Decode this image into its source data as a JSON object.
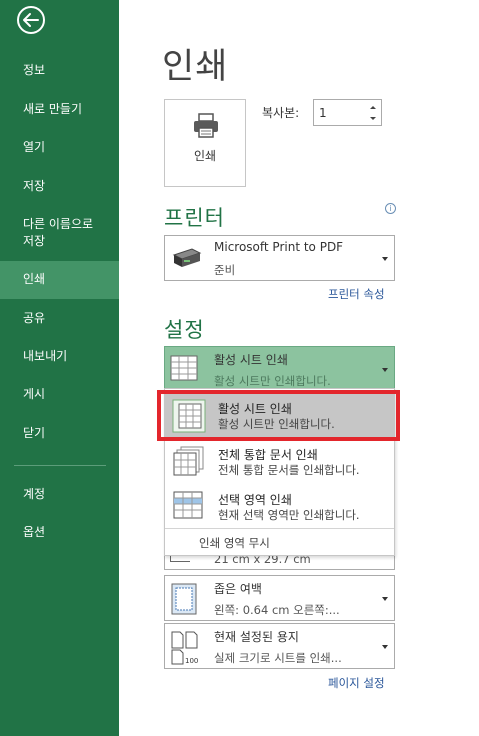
{
  "sidebar": {
    "back_icon": "back-arrow-icon",
    "items": [
      {
        "label": "정보"
      },
      {
        "label": "새로 만들기"
      },
      {
        "label": "열기"
      },
      {
        "label": "저장"
      },
      {
        "label": "다른 이름으로\n저장"
      },
      {
        "label": "인쇄",
        "active": true
      },
      {
        "label": "공유"
      },
      {
        "label": "내보내기"
      },
      {
        "label": "게시"
      },
      {
        "label": "닫기"
      },
      {
        "label": "계정"
      },
      {
        "label": "옵션"
      }
    ]
  },
  "main": {
    "title": "인쇄",
    "print_button_label": "인쇄",
    "copies_label": "복사본:",
    "copies_value": "1",
    "printer_section_title": "프린터",
    "printer": {
      "name": "Microsoft Print to PDF",
      "status": "준비"
    },
    "printer_properties_link": "프린터 속성",
    "settings_section_title": "설정",
    "settings_dropdown": {
      "main": "활성 시트 인쇄",
      "sub": "활성 시트만 인쇄합니다."
    },
    "menu": {
      "items": [
        {
          "main": "활성 시트 인쇄",
          "sub": "활성 시트만 인쇄합니다.",
          "selected": true
        },
        {
          "main": "전체 통합 문서 인쇄",
          "sub": "전체 통합 문서를 인쇄합니다."
        },
        {
          "main": "선택 영역 인쇄",
          "sub": "현재 선택 영역만 인쇄합니다."
        }
      ],
      "footer": "인쇄 영역 무시"
    },
    "paper_size_partial": "21 cm x 29.7 cm",
    "margins": {
      "main": "좁은 여백",
      "sub": "왼쪽:  0.64 cm     오른쪽:..."
    },
    "scaling": {
      "main": "현재 설정된 용지",
      "sub": "실제 크기로 시트를 인쇄..."
    },
    "page_setup_link": "페이지 설정"
  },
  "colors": {
    "accent": "#217346",
    "active_nav": "#439467",
    "highlight": "#e3262c",
    "selected_bg": "#8cc39f"
  }
}
